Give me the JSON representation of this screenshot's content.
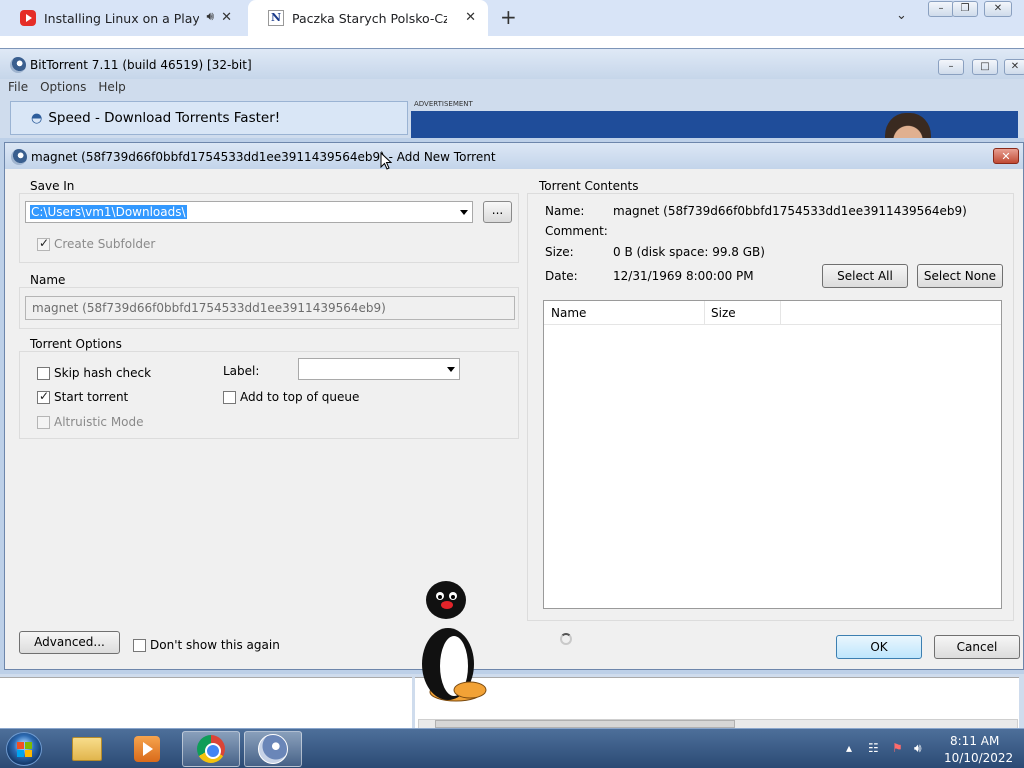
{
  "browser": {
    "tabs": [
      {
        "title": "Installing Linux on a PlayStat"
      },
      {
        "title": "Paczka Starych Polsko-Czeskich B"
      }
    ]
  },
  "bittorrent": {
    "window_title": "BitTorrent 7.11  (build 46519) [32-bit]",
    "menu": [
      "File",
      "Options",
      "Help"
    ],
    "speed_banner": "Speed - Download Torrents Faster!",
    "ad_label": "ADVERTISEMENT"
  },
  "dialog": {
    "title": "magnet (58f739d66f0bbfd1754533dd1ee3911439564eb9) - Add New Torrent",
    "save_in": {
      "label": "Save In",
      "path": "C:\\Users\\vm1\\Downloads\\",
      "browse_label": "...",
      "create_subfolder": "Create Subfolder"
    },
    "name": {
      "label": "Name",
      "value": "magnet (58f739d66f0bbfd1754533dd1ee3911439564eb9)"
    },
    "options": {
      "label": "Torrent Options",
      "skip_hash": "Skip hash check",
      "start_torrent": "Start torrent",
      "altruistic": "Altruistic Mode",
      "label_field": "Label:",
      "add_to_top": "Add to top of queue"
    },
    "contents": {
      "label": "Torrent Contents",
      "name_key": "Name:",
      "name_val": "magnet (58f739d66f0bbfd1754533dd1ee3911439564eb9)",
      "comment_key": "Comment:",
      "size_key": "Size:",
      "size_val": "0 B (disk space: 99.8 GB)",
      "date_key": "Date:",
      "date_val": "12/31/1969 8:00:00 PM",
      "select_all": "Select All",
      "select_none": "Select None",
      "columns": [
        "Name",
        "Size"
      ]
    },
    "advanced_label": "Advanced...",
    "dont_show": "Don't show this again",
    "ok_label": "OK",
    "cancel_label": "Cancel"
  },
  "taskbar": {
    "time": "8:11 AM",
    "date": "10/10/2022"
  }
}
